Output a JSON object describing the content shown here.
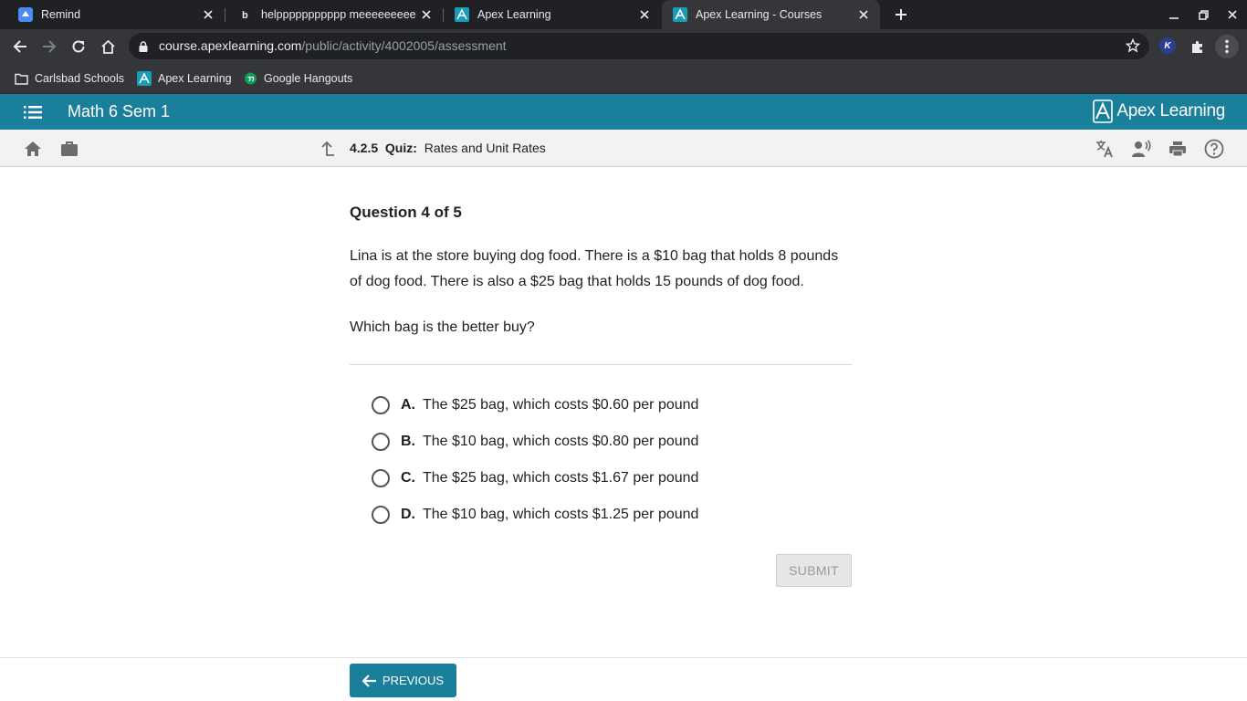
{
  "browser": {
    "tabs": [
      {
        "title": "Remind",
        "icon": "remind-icon",
        "active": false
      },
      {
        "title": "helppppppppppp meeeeeeeeee -",
        "icon": "brainly-icon",
        "active": false
      },
      {
        "title": "Apex Learning",
        "icon": "apex-icon",
        "active": false
      },
      {
        "title": "Apex Learning - Courses",
        "icon": "apex-icon",
        "active": true
      }
    ],
    "address": {
      "host": "course.apexlearning.com",
      "path": "/public/activity/4002005/assessment"
    },
    "bookmarks": [
      {
        "label": "Carlsbad Schools",
        "icon": "folder-icon"
      },
      {
        "label": "Apex Learning",
        "icon": "apex-icon"
      },
      {
        "label": "Google Hangouts",
        "icon": "hangouts-icon"
      }
    ],
    "extension_badge": "K"
  },
  "app": {
    "course_title": "Math 6 Sem 1",
    "brand": "Apex Learning",
    "brand_color": "#1a7f9b"
  },
  "breadcrumb": {
    "number": "4.2.5",
    "type": "Quiz:",
    "title": "Rates and Unit Rates"
  },
  "question": {
    "counter": "Question 4 of 5",
    "prompt": "Lina is at the store buying dog food. There is a $10 bag that holds 8 pounds of dog food. There is also a $25 bag that holds 15 pounds of dog food.",
    "ask": "Which bag is the better buy?",
    "options": [
      {
        "letter": "A.",
        "text": "The $25 bag, which costs $0.60 per pound"
      },
      {
        "letter": "B.",
        "text": "The $10 bag, which costs $0.80 per pound"
      },
      {
        "letter": "C.",
        "text": "The $25 bag, which costs $1.67 per pound"
      },
      {
        "letter": "D.",
        "text": "The $10 bag, which costs $1.25 per pound"
      }
    ],
    "submit_label": "SUBMIT"
  },
  "footer": {
    "previous_label": "PREVIOUS"
  }
}
